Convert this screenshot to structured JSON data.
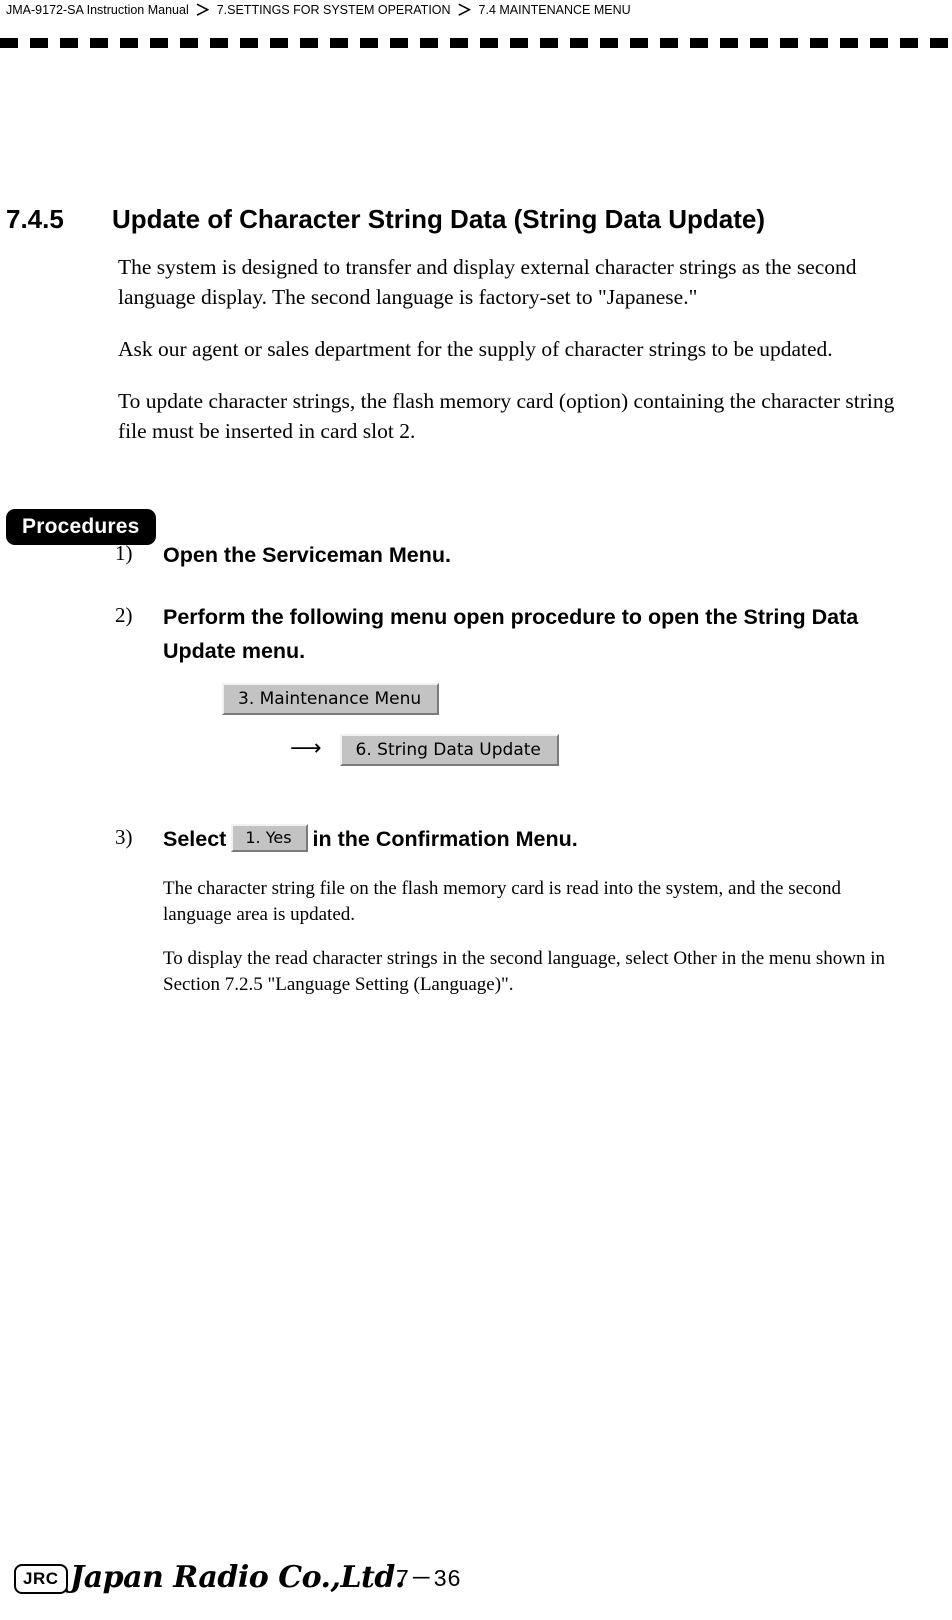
{
  "header": {
    "manual": "JMA-9172-SA Instruction Manual",
    "separator": "＞",
    "chapter": "7.SETTINGS FOR SYSTEM OPERATION",
    "section": "7.4  MAINTENANCE MENU"
  },
  "heading": {
    "number": "7.4.5",
    "title": "Update of Character String Data  (String Data Update)"
  },
  "intro_paragraphs": [
    "The system is designed to transfer and display external character strings as the second language display. The second language is factory-set to \"Japanese.\"",
    "Ask our agent or sales department for the supply of character strings to be updated.",
    "To update character strings, the flash memory card (option) containing the character string file must be inserted in card slot 2."
  ],
  "procedures": {
    "badge_label": "Procedures",
    "steps": [
      {
        "number": "1)",
        "text": "Open the Serviceman Menu."
      },
      {
        "number": "2)",
        "text": "Perform the following menu open procedure to open the String Data Update menu."
      }
    ],
    "menu_flow": {
      "key1": "3. Maintenance Menu",
      "arrow": "⟶",
      "key2": "6. String Data Update"
    },
    "step3": {
      "number": "3)",
      "text_before": "Select",
      "key": "1. Yes",
      "text_after": "in the Confirmation Menu."
    },
    "notes": [
      "The character string file on the flash memory card is read into the system, and the second language area is updated.",
      "To display the read character strings in the second language, select  Other  in the menu shown in Section 7.2.5 \"Language Setting (Language)\"."
    ]
  },
  "footer": {
    "logo_mark": "JRC",
    "company": "Japan Radio Co.,Ltd.",
    "page": "7－36"
  },
  "colors": {
    "page_background": "#ffffff",
    "text": "#000000",
    "badge_background": "#000000",
    "badge_text": "#ffffff",
    "key_face": "#c3c3c3",
    "key_highlight": "#f2f2f2",
    "key_shadow": "#7a7a7a"
  }
}
